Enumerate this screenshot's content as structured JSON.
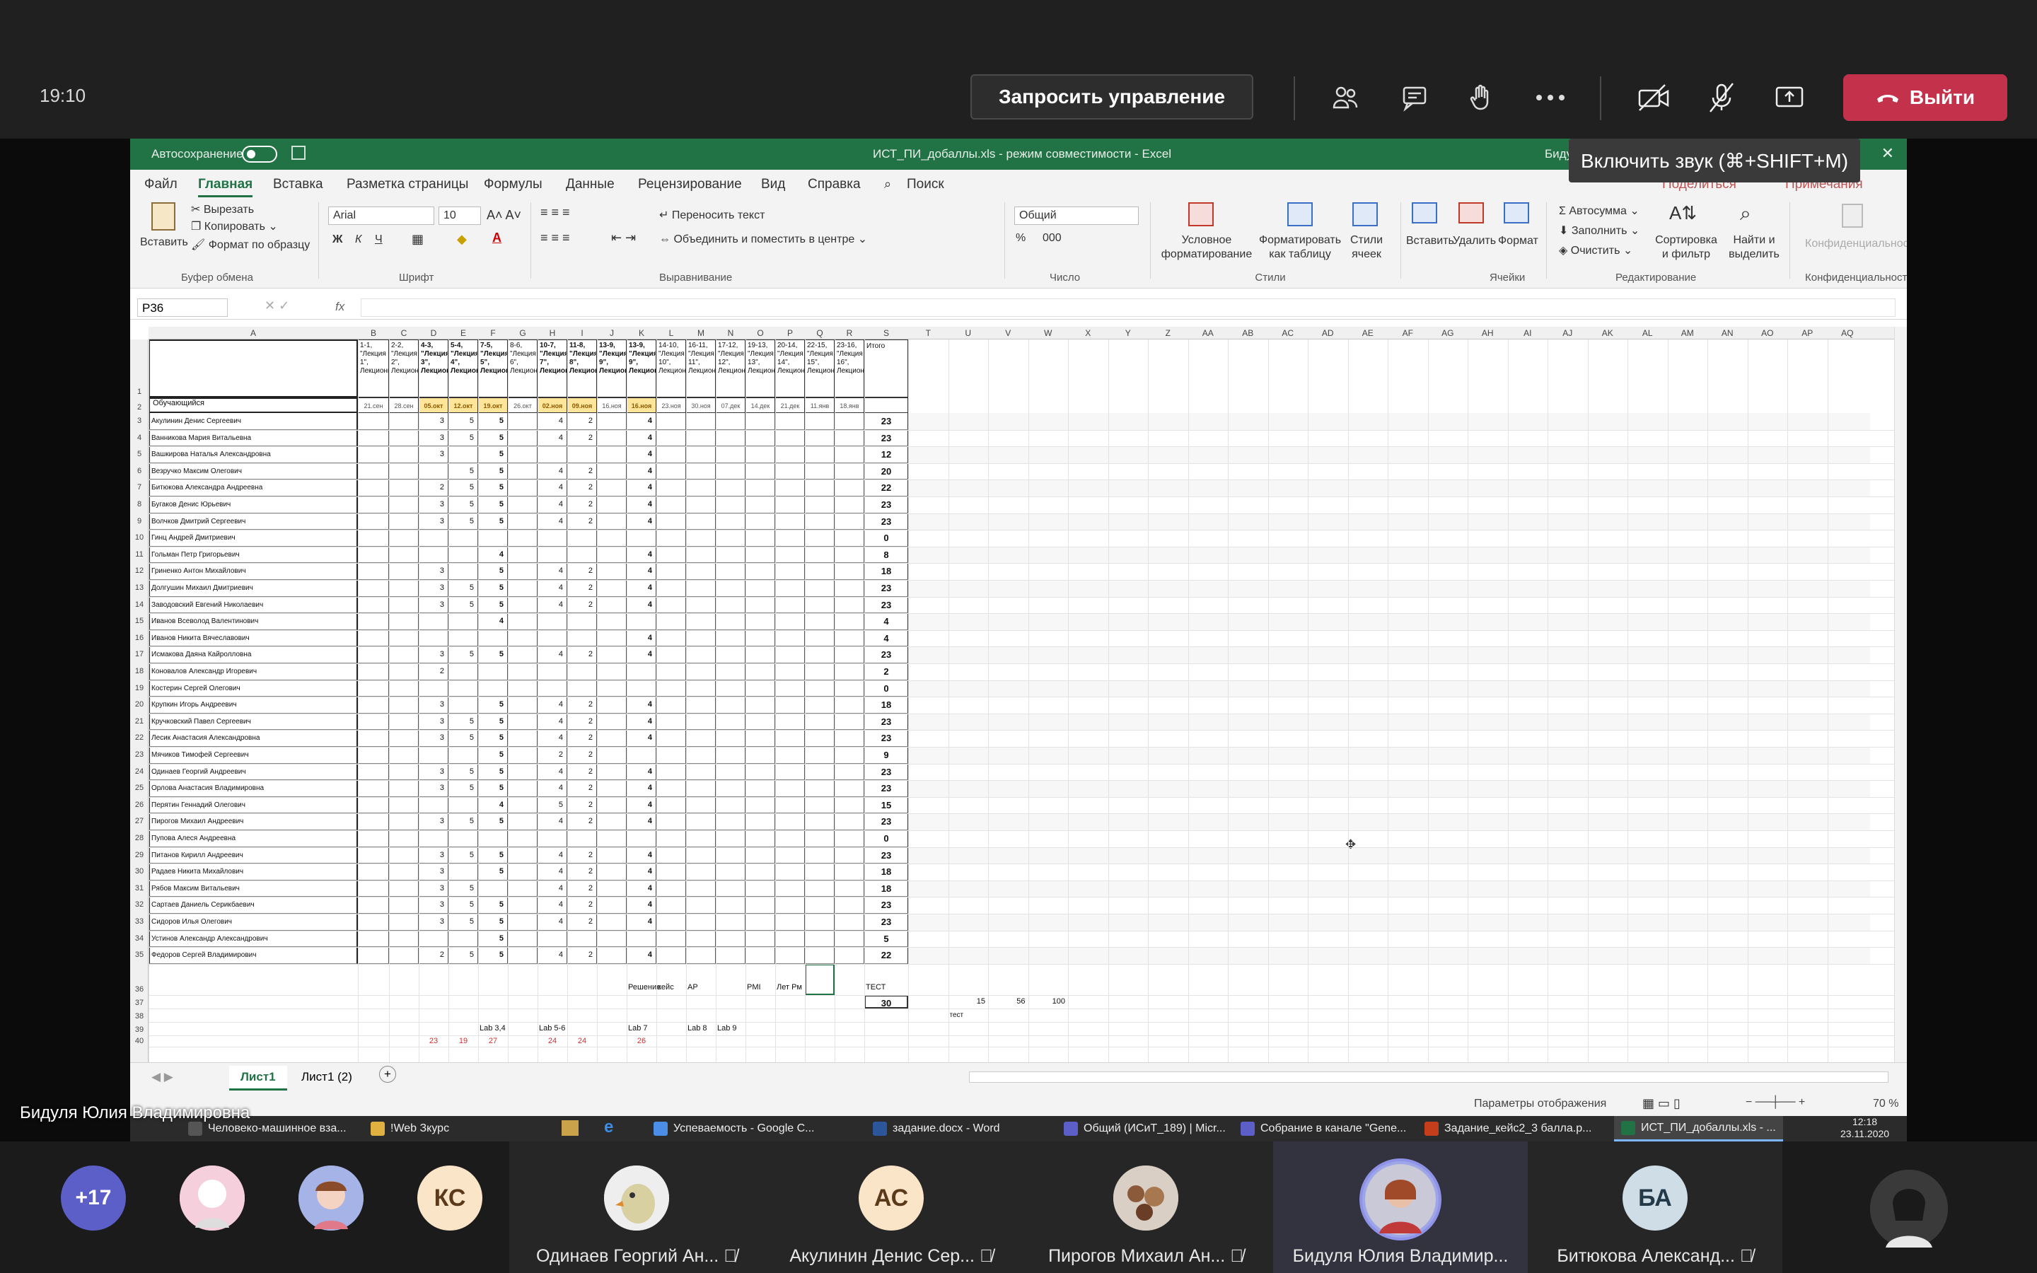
{
  "meeting": {
    "clock": "19:10",
    "request_control": "Запросить управление",
    "leave": "Выйти",
    "tooltip": "Включить звук (⌘+SHIFT+M)",
    "presenter_label": "Бидуля Юлия Владимировна"
  },
  "excel": {
    "autosave": "Автосохранение",
    "title": "ИСТ_ПИ_добаллы.xls  -  режим совместимости  -  Excel",
    "user": "Бидул",
    "share": "Поделиться",
    "notes": "Примечания",
    "tabs": [
      "Файл",
      "Главная",
      "Вставка",
      "Разметка страницы",
      "Формулы",
      "Данные",
      "Рецензирование",
      "Вид",
      "Справка"
    ],
    "search": "Поиск",
    "clipboard": {
      "paste": "Вставить",
      "cut": "Вырезать",
      "copy": "Копировать",
      "format": "Формат по образцу",
      "group": "Буфер обмена"
    },
    "font": {
      "name": "Arial",
      "size": "10",
      "group": "Шрифт",
      "bold": "Ж",
      "italic": "К",
      "underline": "Ч"
    },
    "alignment": {
      "wrap": "Переносить текст",
      "merge": "Объединить и поместить в центре",
      "group": "Выравнивание"
    },
    "number": {
      "format": "Общий",
      "group": "Число",
      "percent": "%",
      "thousands": "000"
    },
    "styles": {
      "cond": "Условное форматирование",
      "table": "Форматировать как таблицу",
      "cell": "Стили ячеек",
      "group": "Стили"
    },
    "cells": {
      "insert": "Вставить",
      "delete": "Удалить",
      "format": "Формат",
      "group": "Ячейки"
    },
    "editing": {
      "autosum": "Автосумма",
      "fill": "Заполнить",
      "clear": "Очистить",
      "sort": "Сортировка и фильтр",
      "find": "Найти и выделить",
      "group": "Редактирование"
    },
    "privacy": {
      "label": "Конфиденциальность",
      "group": "Конфиденциальность"
    },
    "name_box": "P36",
    "fx": "fx",
    "col_letters": [
      "A",
      "B",
      "C",
      "D",
      "E",
      "F",
      "G",
      "H",
      "I",
      "J",
      "K",
      "L",
      "M",
      "N",
      "O",
      "P",
      "Q",
      "R",
      "S",
      "T",
      "U",
      "V",
      "W",
      "X",
      "Y",
      "Z",
      "AA",
      "AB",
      "AC",
      "AD",
      "AE",
      "AF",
      "AG",
      "AH",
      "AI",
      "AJ",
      "AK",
      "AL",
      "AM",
      "AN",
      "AO",
      "AP",
      "AQ"
    ],
    "lecture_headers": [
      "1-1, \"Лекция 1\", Лекционное",
      "2-2, \"Лекция 2\", Лекционное",
      "4-3, \"Лекция 3\", Лекционное",
      "5-4, \"Лекция 4\", Лекционное",
      "7-5, \"Лекция 5\", Лекционное",
      "8-6, \"Лекция 6\", Лекционное",
      "10-7, \"Лекция 7\", Лекционное",
      "11-8, \"Лекция 8\", Лекционное",
      "13-9, \"Лекция 9\", Лекционное",
      "13-9, \"Лекция 9\", Лекционное",
      "14-10, \"Лекция 10\", Лекционное",
      "16-11, \"Лекция 11\", Лекционное",
      "17-12, \"Лекция 12\", Лекционное",
      "19-13, \"Лекция 13\", Лекционное",
      "20-14, \"Лекция 14\", Лекционное",
      "22-15, \"Лекция 15\", Лекционное",
      "23-16, \"Лекция 16\", Лекционное"
    ],
    "total_header": "Итого",
    "students_header": "Обучающийся",
    "dates": [
      "21.сен",
      "28.сен",
      "05.окт",
      "12.окт",
      "19.окт",
      "26.окт",
      "02.ноя",
      "09.ноя",
      "16.ноя",
      "16.ноя",
      "23.ноя",
      "30.ноя",
      "07.дек",
      "14.дек",
      "21.дек",
      "11.янв",
      "18.янв"
    ],
    "students": [
      {
        "n": "3",
        "name": "Акулинин Денис Сергеевич",
        "v": [
          "",
          "",
          "3",
          "5",
          "5",
          "",
          "4",
          "2",
          "",
          "4",
          "",
          "",
          "",
          "",
          "",
          "",
          ""
        ],
        "t": "23"
      },
      {
        "n": "4",
        "name": "Ванникова Мария Витальевна",
        "v": [
          "",
          "",
          "3",
          "5",
          "5",
          "",
          "4",
          "2",
          "",
          "4",
          "",
          "",
          "",
          "",
          "",
          "",
          ""
        ],
        "t": "23"
      },
      {
        "n": "5",
        "name": "Вашкирова Наталья Александровна",
        "v": [
          "",
          "",
          "3",
          "",
          "5",
          "",
          "",
          "",
          "",
          "4",
          "",
          "",
          "",
          "",
          "",
          "",
          ""
        ],
        "t": "12"
      },
      {
        "n": "6",
        "name": "Везручко Максим Олегович",
        "v": [
          "",
          "",
          "",
          "5",
          "5",
          "",
          "4",
          "2",
          "",
          "4",
          "",
          "",
          "",
          "",
          "",
          "",
          ""
        ],
        "t": "20"
      },
      {
        "n": "7",
        "name": "Битюкова Александра Андреевна",
        "v": [
          "",
          "",
          "2",
          "5",
          "5",
          "",
          "4",
          "2",
          "",
          "4",
          "",
          "",
          "",
          "",
          "",
          "",
          ""
        ],
        "t": "22"
      },
      {
        "n": "8",
        "name": "Бугаков Денис Юрьевич",
        "v": [
          "",
          "",
          "3",
          "5",
          "5",
          "",
          "4",
          "2",
          "",
          "4",
          "",
          "",
          "",
          "",
          "",
          "",
          ""
        ],
        "t": "23"
      },
      {
        "n": "9",
        "name": "Волчков Дмитрий Сергеевич",
        "v": [
          "",
          "",
          "3",
          "5",
          "5",
          "",
          "4",
          "2",
          "",
          "4",
          "",
          "",
          "",
          "",
          "",
          "",
          ""
        ],
        "t": "23"
      },
      {
        "n": "10",
        "name": "Гинц Андрей Дмитриевич",
        "v": [
          "",
          "",
          "",
          "",
          "",
          "",
          "",
          "",
          "",
          "",
          "",
          "",
          "",
          "",
          "",
          "",
          ""
        ],
        "t": "0"
      },
      {
        "n": "11",
        "name": "Гольман Петр Григорьевич",
        "v": [
          "",
          "",
          "",
          "",
          "4",
          "",
          "",
          "",
          "",
          "4",
          "",
          "",
          "",
          "",
          "",
          "",
          ""
        ],
        "t": "8"
      },
      {
        "n": "12",
        "name": "Гриненко Антон Михайлович",
        "v": [
          "",
          "",
          "3",
          "",
          "5",
          "",
          "4",
          "2",
          "",
          "4",
          "",
          "",
          "",
          "",
          "",
          "",
          ""
        ],
        "t": "18"
      },
      {
        "n": "13",
        "name": "Долгушин Михаил Дмитриевич",
        "v": [
          "",
          "",
          "3",
          "5",
          "5",
          "",
          "4",
          "2",
          "",
          "4",
          "",
          "",
          "",
          "",
          "",
          "",
          ""
        ],
        "t": "23"
      },
      {
        "n": "14",
        "name": "Заводовский Евгений Николаевич",
        "v": [
          "",
          "",
          "3",
          "5",
          "5",
          "",
          "4",
          "2",
          "",
          "4",
          "",
          "",
          "",
          "",
          "",
          "",
          ""
        ],
        "t": "23"
      },
      {
        "n": "15",
        "name": "Иванов Всеволод Валентинович",
        "v": [
          "",
          "",
          "",
          "",
          "4",
          "",
          "",
          "",
          "",
          "",
          "",
          "",
          "",
          "",
          "",
          "",
          ""
        ],
        "t": "4"
      },
      {
        "n": "16",
        "name": "Иванов Никита Вячеславович",
        "v": [
          "",
          "",
          "",
          "",
          "",
          "",
          "",
          "",
          "",
          "4",
          "",
          "",
          "",
          "",
          "",
          "",
          ""
        ],
        "t": "4"
      },
      {
        "n": "17",
        "name": "Исмакова Даяна Кайролловна",
        "v": [
          "",
          "",
          "3",
          "5",
          "5",
          "",
          "4",
          "2",
          "",
          "4",
          "",
          "",
          "",
          "",
          "",
          "",
          ""
        ],
        "t": "23"
      },
      {
        "n": "18",
        "name": "Коновалов Александр Игоревич",
        "v": [
          "",
          "",
          "2",
          "",
          "",
          "",
          "",
          "",
          "",
          "",
          "",
          "",
          "",
          "",
          "",
          "",
          ""
        ],
        "t": "2"
      },
      {
        "n": "19",
        "name": "Костерин Сергей Олегович",
        "v": [
          "",
          "",
          "",
          "",
          "",
          "",
          "",
          "",
          "",
          "",
          "",
          "",
          "",
          "",
          "",
          "",
          ""
        ],
        "t": "0"
      },
      {
        "n": "20",
        "name": "Крупкин Игорь Андреевич",
        "v": [
          "",
          "",
          "3",
          "",
          "5",
          "",
          "4",
          "2",
          "",
          "4",
          "",
          "",
          "",
          "",
          "",
          "",
          ""
        ],
        "t": "18"
      },
      {
        "n": "21",
        "name": "Кручковский Павел Сергеевич",
        "v": [
          "",
          "",
          "3",
          "5",
          "5",
          "",
          "4",
          "2",
          "",
          "4",
          "",
          "",
          "",
          "",
          "",
          "",
          ""
        ],
        "t": "23"
      },
      {
        "n": "22",
        "name": "Лесик Анастасия Александровна",
        "v": [
          "",
          "",
          "3",
          "5",
          "5",
          "",
          "4",
          "2",
          "",
          "4",
          "",
          "",
          "",
          "",
          "",
          "",
          ""
        ],
        "t": "23"
      },
      {
        "n": "23",
        "name": "Мячиков Тимофей Сергеевич",
        "v": [
          "",
          "",
          "",
          "",
          "5",
          "",
          "2",
          "2",
          "",
          "",
          "",
          "",
          "",
          "",
          "",
          "",
          ""
        ],
        "t": "9"
      },
      {
        "n": "24",
        "name": "Одинаев Георгий Андреевич",
        "v": [
          "",
          "",
          "3",
          "5",
          "5",
          "",
          "4",
          "2",
          "",
          "4",
          "",
          "",
          "",
          "",
          "",
          "",
          ""
        ],
        "t": "23"
      },
      {
        "n": "25",
        "name": "Орлова Анастасия Владимировна",
        "v": [
          "",
          "",
          "3",
          "5",
          "5",
          "",
          "4",
          "2",
          "",
          "4",
          "",
          "",
          "",
          "",
          "",
          "",
          ""
        ],
        "t": "23"
      },
      {
        "n": "26",
        "name": "Перятин Геннадий Олегович",
        "v": [
          "",
          "",
          "",
          "",
          "4",
          "",
          "5",
          "2",
          "",
          "4",
          "",
          "",
          "",
          "",
          "",
          "",
          ""
        ],
        "t": "15"
      },
      {
        "n": "27",
        "name": "Пирогов Михаил Андреевич",
        "v": [
          "",
          "",
          "3",
          "5",
          "5",
          "",
          "4",
          "2",
          "",
          "4",
          "",
          "",
          "",
          "",
          "",
          "",
          ""
        ],
        "t": "23"
      },
      {
        "n": "28",
        "name": "Пупова Алеся Андреевна",
        "v": [
          "",
          "",
          "",
          "",
          "",
          "",
          "",
          "",
          "",
          "",
          "",
          "",
          "",
          "",
          "",
          "",
          ""
        ],
        "t": "0"
      },
      {
        "n": "29",
        "name": "Питанов Кирилл Андреевич",
        "v": [
          "",
          "",
          "3",
          "5",
          "5",
          "",
          "4",
          "2",
          "",
          "4",
          "",
          "",
          "",
          "",
          "",
          "",
          ""
        ],
        "t": "23"
      },
      {
        "n": "30",
        "name": "Радаев Никита Михайлович",
        "v": [
          "",
          "",
          "3",
          "",
          "5",
          "",
          "4",
          "2",
          "",
          "4",
          "",
          "",
          "",
          "",
          "",
          "",
          ""
        ],
        "t": "18"
      },
      {
        "n": "31",
        "name": "Рябов Максим Витальевич",
        "v": [
          "",
          "",
          "3",
          "5",
          "",
          "",
          "4",
          "2",
          "",
          "4",
          "",
          "",
          "",
          "",
          "",
          "",
          ""
        ],
        "t": "18"
      },
      {
        "n": "32",
        "name": "Сартаев Даниель Серикбаевич",
        "v": [
          "",
          "",
          "3",
          "5",
          "5",
          "",
          "4",
          "2",
          "",
          "4",
          "",
          "",
          "",
          "",
          "",
          "",
          ""
        ],
        "t": "23"
      },
      {
        "n": "33",
        "name": "Сидоров Илья Олегович",
        "v": [
          "",
          "",
          "3",
          "5",
          "5",
          "",
          "4",
          "2",
          "",
          "4",
          "",
          "",
          "",
          "",
          "",
          "",
          ""
        ],
        "t": "23"
      },
      {
        "n": "34",
        "name": "Устинов Александр Александрович",
        "v": [
          "",
          "",
          "",
          "",
          "5",
          "",
          "",
          "",
          "",
          "",
          "",
          "",
          "",
          "",
          "",
          "",
          ""
        ],
        "t": "5"
      },
      {
        "n": "35",
        "name": "Федоров Сергей Владимирович",
        "v": [
          "",
          "",
          "2",
          "5",
          "5",
          "",
          "4",
          "2",
          "",
          "4",
          "",
          "",
          "",
          "",
          "",
          "",
          ""
        ],
        "t": "22"
      }
    ],
    "row36_notes": [
      "Решение",
      "кейс",
      "AP",
      "PMI",
      "Лет Рм",
      "ТЕСТ"
    ],
    "row37": {
      "total": "30",
      "u": "15",
      "v": "56",
      "w": "100"
    },
    "row38_test": "тест",
    "row39_labs": [
      "Lab 3,4",
      "Lab 5-6",
      "Lab 7",
      "Lab 8",
      "Lab 9"
    ],
    "row40_vals": [
      "23",
      "19",
      "27",
      "24",
      "24",
      "26"
    ],
    "sheets": [
      "Лист1",
      "Лист1 (2)"
    ],
    "display_settings": "Параметры отображения",
    "zoom": "70 %"
  },
  "taskbar": {
    "items": [
      "Человеко-машинное вза...",
      "!Web Зкурс",
      "Успеваемость - Google C...",
      "задание.docx - Word",
      "Общий (ИСиТ_189) | Micr...",
      "Собрание в канале \"Gene...",
      "Задание_кейс2_3 балла.p...",
      "ИСТ_ПИ_добаллы.xls - ..."
    ],
    "time": "12:18",
    "date": "23.11.2020"
  },
  "participants": {
    "more": "+17",
    "initials": [
      {
        "t": "КС"
      },
      {
        "t": "АС"
      },
      {
        "t": "БА"
      }
    ],
    "names": [
      "Одинаев Георгий Ан...",
      "Акулинин Денис Сер...",
      "Пирогов Михаил Ан...",
      "Бидуля Юлия Владимир...",
      "Битюкова Александ..."
    ]
  },
  "colors": {
    "excel_green": "#217346",
    "leave_red": "#c4314b",
    "highlight_yellow": "#ffe59a",
    "teams_bar": "#202020"
  }
}
